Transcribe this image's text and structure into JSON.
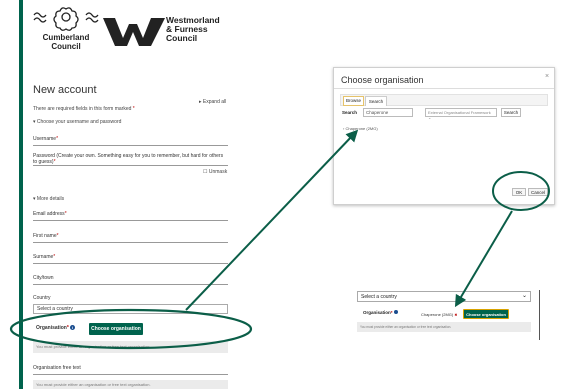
{
  "logos": {
    "cumberland_line1": "Cumberland",
    "cumberland_line2": "Council",
    "westmorland_line1": "Westmorland",
    "westmorland_line2": "& Furness",
    "westmorland_line3": "Council"
  },
  "form": {
    "title": "New account",
    "required_note": "There are required fields in this form marked",
    "expand_all": "Expand all",
    "section_username": "Choose your username and password",
    "username_label": "Username",
    "password_label": "Password (Create your own. Something easy for you to remember, but hard for others to guess)",
    "unmask": "Unmask",
    "section_more": "More details",
    "email_label": "Email address",
    "first_name_label": "First name",
    "surname_label": "Surname",
    "city_label": "City/town",
    "country_label": "Country",
    "country_select": "Select a country",
    "organisation_label": "Organisation",
    "choose_org_button": "Choose organisation",
    "org_error": "You must provide either an organisation or free text organisation.",
    "org_free_text_label": "Organisation free text",
    "org_free_text_error": "You must provide either an organisation or free text organisation."
  },
  "dialog": {
    "title": "Choose organisation",
    "close": "×",
    "tab_browse": "Browse",
    "tab_search": "Search",
    "search_label": "Search",
    "search_value": "Chaperone",
    "filter_select": "External Organisational Framework",
    "search_button": "Search",
    "result": "Chaperone (2MG)",
    "ok_button": "OK",
    "cancel_button": "Cancel"
  },
  "inset": {
    "country_select": "Select a country",
    "organisation_label": "Organisation",
    "selected_value": "Chaperone (2MG)",
    "remove": "✖",
    "choose_org_button": "Choose organisation",
    "org_error": "You must provide either an organisation or free text organisation."
  },
  "colors": {
    "brand_green": "#00634d",
    "annotation_green": "#0b5e48",
    "required_red": "#b00000"
  }
}
